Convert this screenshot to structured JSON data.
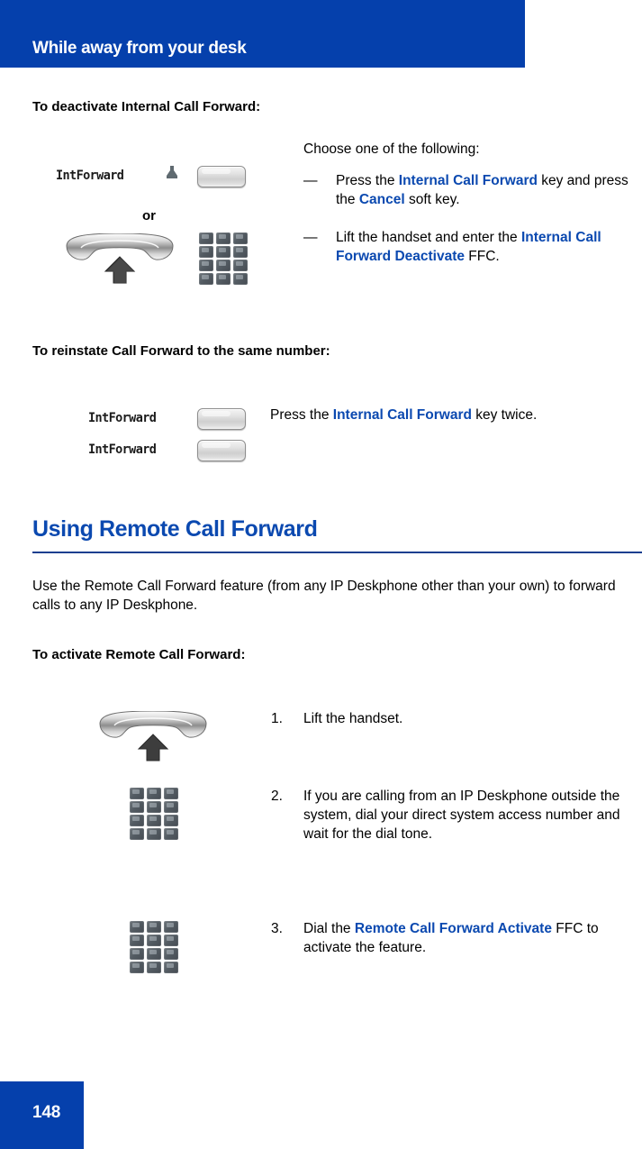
{
  "page": {
    "running_header": "While away from your desk",
    "page_number": "148",
    "header_color": "#0540ac",
    "accent_blue": "#0b49b0"
  },
  "sections": {
    "deactivate": {
      "heading": "To deactivate Internal Call Forward:",
      "intro": "Choose one of the following:",
      "bullets": [
        {
          "marker": "—",
          "parts": [
            {
              "text": "Press the ",
              "style": "plain"
            },
            {
              "text": "Internal Call Forward",
              "style": "blue"
            },
            {
              "text": " key and press the ",
              "style": "plain"
            },
            {
              "text": "Cancel",
              "style": "blue"
            },
            {
              "text": " soft key.",
              "style": "plain"
            }
          ]
        },
        {
          "marker": "—",
          "parts": [
            {
              "text": "Lift the handset and enter the ",
              "style": "plain"
            },
            {
              "text": "Internal Call Forward Deactivate",
              "style": "blue"
            },
            {
              "text": " FFC.",
              "style": "plain"
            }
          ]
        }
      ],
      "icons": {
        "key_label": "IntForward",
        "press_icon": "press-cursor-icon",
        "softkey": "soft-key-button",
        "or_label": "or",
        "handset": "handset-lift-icon",
        "keypad": "dialpad-icon"
      }
    },
    "reinstate": {
      "heading": "To reinstate Call Forward to the same number:",
      "instruction_parts": [
        {
          "text": "Press the ",
          "style": "plain"
        },
        {
          "text": "Internal Call Forward",
          "style": "blue"
        },
        {
          "text": " key twice.",
          "style": "plain"
        }
      ],
      "key_label_1": "IntForward",
      "key_label_2": "IntForward"
    },
    "remote": {
      "chapter_heading": "Using Remote Call Forward",
      "intro": "Use the Remote Call Forward feature (from any IP Deskphone other than your own) to forward calls to any IP Deskphone.",
      "sub_heading": "To activate Remote Call Forward:",
      "steps": [
        {
          "number": "1.",
          "icon": "handset-lift-icon",
          "parts": [
            {
              "text": "Lift the handset.",
              "style": "plain"
            }
          ]
        },
        {
          "number": "2.",
          "icon": "dialpad-icon",
          "parts": [
            {
              "text": "If you are calling from an IP Deskphone outside the system, dial your direct system access number and wait for the dial tone.",
              "style": "plain"
            }
          ]
        },
        {
          "number": "3.",
          "icon": "dialpad-icon",
          "parts": [
            {
              "text": "Dial the ",
              "style": "plain"
            },
            {
              "text": "Remote Call Forward Activate",
              "style": "blue"
            },
            {
              "text": " FFC to activate the feature.",
              "style": "plain"
            }
          ]
        }
      ]
    }
  }
}
